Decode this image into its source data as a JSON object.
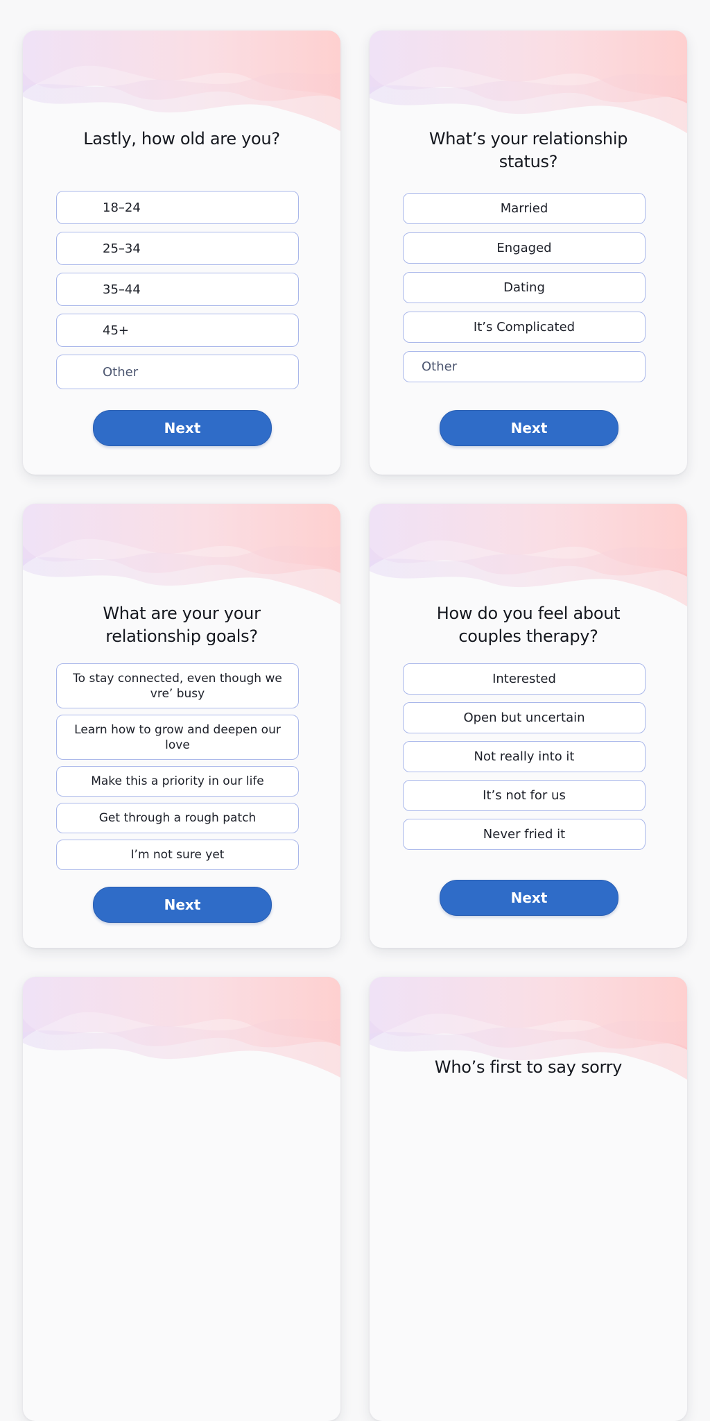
{
  "cards": [
    {
      "question": "Lastly, how old are you?",
      "options": [
        "18–24",
        "25–34",
        "35–44",
        "45+",
        "Other"
      ],
      "next_label": "Next"
    },
    {
      "question": "What’s your relationship status?",
      "options": [
        "Married",
        "Engaged",
        "Dating",
        "It’s Complicated",
        "Other"
      ],
      "next_label": "Next"
    },
    {
      "question": "What are your your relationship goals?",
      "options": [
        "To stay connected, even though we vre’ busy",
        "Learn how to grow and deepen our love",
        "Make this a priority in our life",
        "Get through a rough patch",
        "I’m not sure yet"
      ],
      "next_label": "Next"
    },
    {
      "question": "How do you feel about couples therapy?",
      "options": [
        "Interested",
        "Open but uncertain",
        "Not really into it",
        "It’s not for us",
        "Never fried it"
      ],
      "next_label": "Next"
    },
    {
      "question": ""
    },
    {
      "question": "Who’s first to say sorry"
    }
  ],
  "colors": {
    "card_background": "#fafafb",
    "option_border": "#a9b7ea",
    "button_background": "#2f6cc8",
    "button_text": "#ffffff",
    "wave_pink": "#fdc7c9",
    "wave_lavender": "#eddcf4"
  }
}
